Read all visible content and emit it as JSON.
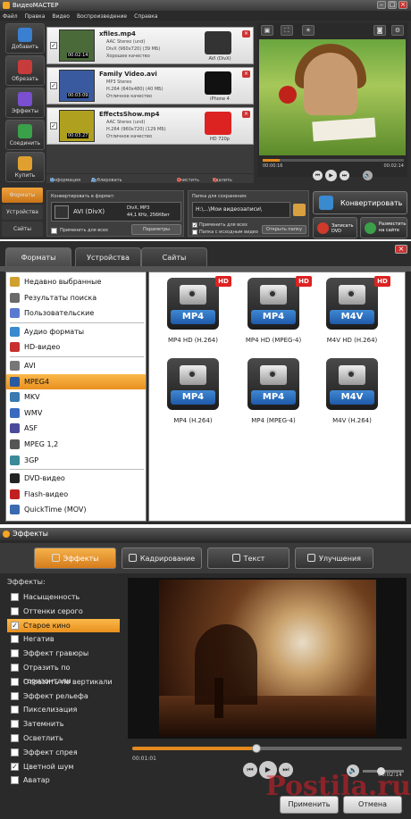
{
  "app": {
    "title": "ВидеоМАСТЕР",
    "menu": [
      "Файл",
      "Правка",
      "Видео",
      "Воспроизведение",
      "Справка"
    ],
    "sidebar": [
      {
        "label": "Добавить",
        "icon": "add-icon",
        "color": "#3a7fd0"
      },
      {
        "label": "Обрезать",
        "icon": "cut-icon",
        "color": "#c83b3b"
      },
      {
        "label": "Эффекты",
        "icon": "effects-icon",
        "color": "#7a4fd0"
      },
      {
        "label": "Соединить",
        "icon": "join-icon",
        "color": "#3aa04a"
      },
      {
        "label": "Купить",
        "icon": "cart-icon",
        "color": "#e0a030"
      }
    ],
    "files": [
      {
        "name": "xfiles.mp4",
        "duration": "00:02:14",
        "audio": "AAC Stereo (und)",
        "video": "DivX (960x720) (39 МБ)",
        "quality": "Хорошее качество",
        "device": "AVI (DivX)",
        "device_icon": "avi-icon",
        "thumb_color": "#4a6a3a"
      },
      {
        "name": "Family Video.avi",
        "duration": "00:03:09",
        "audio": "MP3 Stereo",
        "video": "H.264 (640x480) (40 МБ)",
        "quality": "Отличное качество",
        "device": "iPhone 4",
        "device_icon": "iphone-icon",
        "thumb_color": "#3a5aa0"
      },
      {
        "name": "EffectsShow.mp4",
        "duration": "00:03:27",
        "audio": "AAC Stereo (und)",
        "video": "H.264 (960x720) (129 МБ)",
        "quality": "Отличное качество",
        "device": "HD 720p",
        "device_icon": "youtube-icon",
        "thumb_color": "#b0a020"
      }
    ],
    "filebar": [
      "Информация",
      "Дублировать",
      "Очистить",
      "Удалить"
    ],
    "preview": {
      "time_current": "00:00:16",
      "time_total": "00:02:14",
      "progress": 0.12
    },
    "left_tabs": [
      "Форматы",
      "Устройства",
      "Сайты"
    ],
    "convert": {
      "label": "Конвертировать в формат:",
      "format": "AVI (DivX)",
      "codec_line1": "DivX, MP3",
      "codec_line2": "44,1 KHz, 256Кбит",
      "apply_all": "Применить для всех",
      "params": "Параметры"
    },
    "save": {
      "label": "Папка для сохранения:",
      "path": "H:\\...\\Мои видеозаписи\\",
      "apply_all": "Применить для всех",
      "source_folder": "Папка с исходным видео",
      "open_folder": "Открыть папку"
    },
    "convert_button": "Конвертировать",
    "dvd_button": "Записать DVD",
    "web_button": "Разместить на сайте"
  },
  "format_dialog": {
    "tabs": [
      "Форматы",
      "Устройства",
      "Сайты"
    ],
    "categories": [
      {
        "label": "Недавно выбранные",
        "color": "#d0a030"
      },
      {
        "label": "Результаты поиска",
        "color": "#6a6a6a"
      },
      {
        "label": "Пользовательские",
        "color": "#5a7ad0"
      },
      {
        "label": "Аудио форматы",
        "color": "#3a8ad0"
      },
      {
        "label": "HD-видео",
        "color": "#c83030"
      },
      {
        "label": "AVI",
        "color": "#777777"
      },
      {
        "label": "MPEG4",
        "color": "#2a5aa0",
        "selected": true
      },
      {
        "label": "MKV",
        "color": "#3a7ab0"
      },
      {
        "label": "WMV",
        "color": "#3a6ac0"
      },
      {
        "label": "ASF",
        "color": "#4a4a9a"
      },
      {
        "label": "MPEG 1,2",
        "color": "#555555"
      },
      {
        "label": "3GP",
        "color": "#3a8a9a"
      },
      {
        "label": "DVD-видео",
        "color": "#222222"
      },
      {
        "label": "Flash-видео",
        "color": "#c02020"
      },
      {
        "label": "QuickTime (MOV)",
        "color": "#3a6ab0"
      }
    ],
    "formats": [
      {
        "badge": "MP4",
        "hd": true,
        "caption": "MP4 HD (H.264)"
      },
      {
        "badge": "MP4",
        "hd": true,
        "caption": "MP4 HD (MPEG-4)"
      },
      {
        "badge": "M4V",
        "hd": true,
        "caption": "M4V HD (H.264)"
      },
      {
        "badge": "MP4",
        "hd": false,
        "caption": "MP4 (H.264)"
      },
      {
        "badge": "MP4",
        "hd": false,
        "caption": "MP4 (MPEG-4)"
      },
      {
        "badge": "M4V",
        "hd": false,
        "caption": "M4V (H.264)"
      }
    ],
    "hd_label": "HD"
  },
  "effects_dialog": {
    "title": "Эффекты",
    "tabs": [
      "Эффекты",
      "Кадрирование",
      "Текст",
      "Улучшения"
    ],
    "list_label": "Эффекты:",
    "effects": [
      {
        "label": "Насыщенность",
        "checked": false
      },
      {
        "label": "Оттенки серого",
        "checked": false
      },
      {
        "label": "Старое кино",
        "checked": true,
        "selected": true
      },
      {
        "label": "Негатив",
        "checked": false
      },
      {
        "label": "Эффект гравюры",
        "checked": false
      },
      {
        "label": "Отразить по горизонтали",
        "checked": false
      },
      {
        "label": "Отразить по вертикали",
        "checked": false
      },
      {
        "label": "Эффект рельефа",
        "checked": false
      },
      {
        "label": "Пикселизация",
        "checked": false
      },
      {
        "label": "Затемнить",
        "checked": false
      },
      {
        "label": "Осветлить",
        "checked": false
      },
      {
        "label": "Эффект спрея",
        "checked": false
      },
      {
        "label": "Цветной шум",
        "checked": true
      },
      {
        "label": "Аватар",
        "checked": false
      }
    ],
    "time_current": "00:01:01",
    "time_total": "00:02:14",
    "progress": 0.46,
    "apply": "Применить",
    "cancel": "Отмена"
  },
  "watermark": "Postila.ru",
  "colors": {
    "accent": "#e38a1e",
    "selection": "#f5a623",
    "dark": "#2c2c2c"
  }
}
